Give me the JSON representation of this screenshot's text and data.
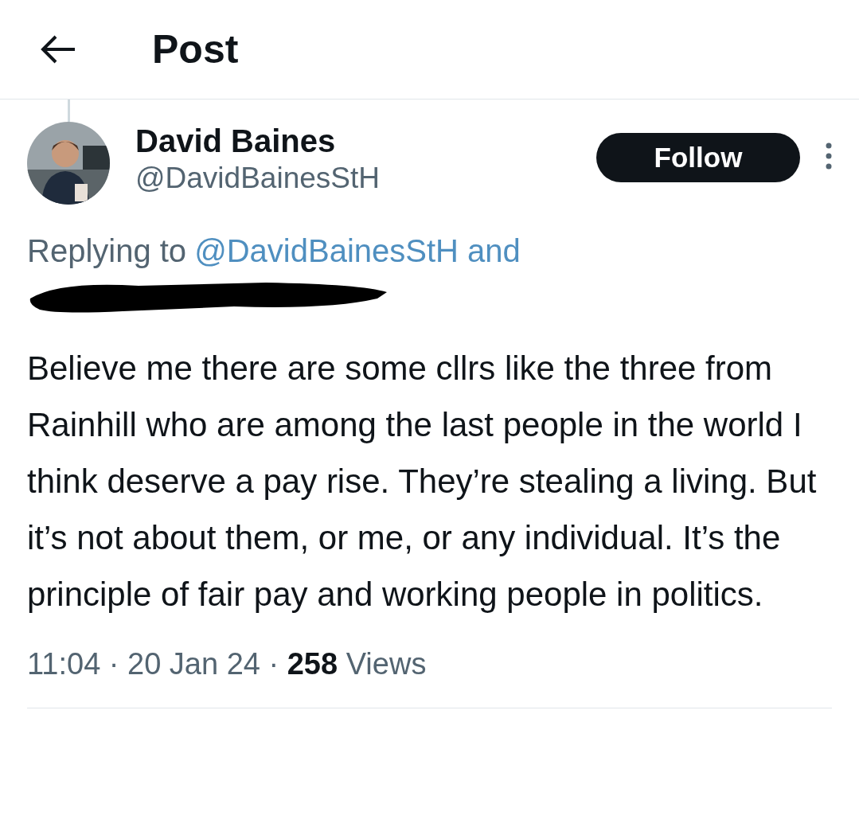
{
  "header": {
    "title": "Post"
  },
  "post": {
    "author": {
      "name": "David Baines",
      "handle": "@DavidBainesStH"
    },
    "follow_button": "Follow",
    "replying": {
      "label": "Replying to",
      "mention": "@DavidBainesStH and"
    },
    "body": "Believe me there are some cllrs like the three from Rainhill who are among the last people in the world I think deserve a pay rise. They’re stealing a living. But it’s not about them, or me, or any individual. It’s the principle of fair pay and working people in politics.",
    "meta": "11:04 · 20 Jan 24 · **258** Views"
  }
}
